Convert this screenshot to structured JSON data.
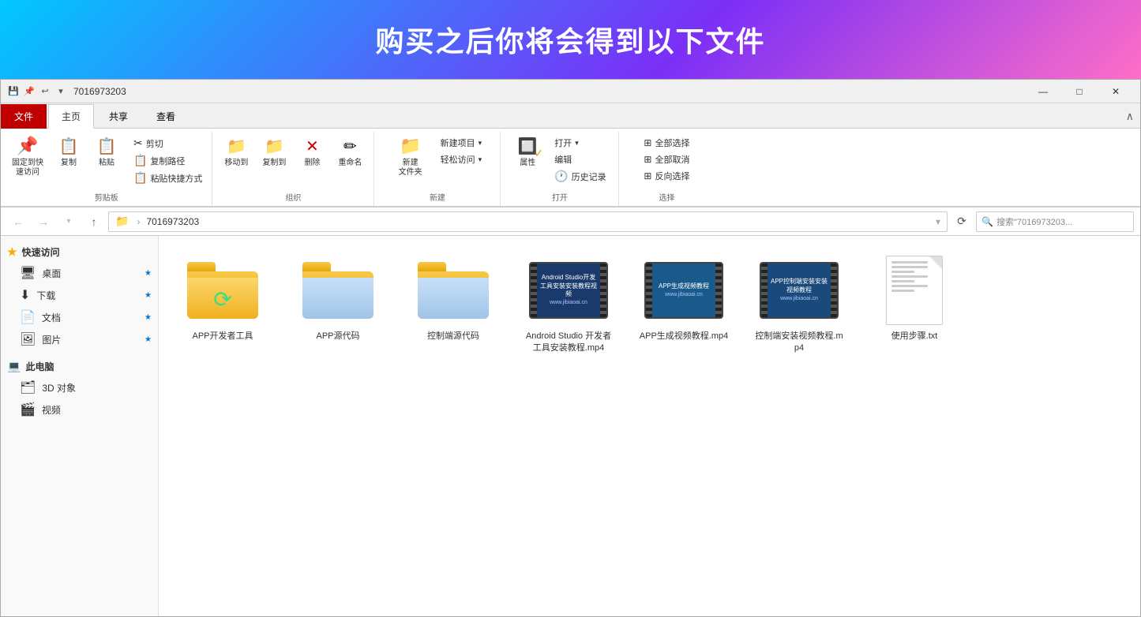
{
  "banner": {
    "title": "购买之后你将会得到以下文件"
  },
  "titlebar": {
    "title": "7016973203",
    "undo_icon": "↩",
    "minimize": "—",
    "maximize": "□",
    "close": "✕"
  },
  "ribbon": {
    "tabs": [
      "文件",
      "主页",
      "共享",
      "查看"
    ],
    "active_tab": "主页",
    "groups": {
      "clipboard": {
        "label": "剪贴板",
        "pin_label": "固定到快\n速访问",
        "copy_label": "复制",
        "paste_label": "粘贴",
        "cut": "剪切",
        "copy_path": "复制路径",
        "paste_shortcut": "粘贴快捷方式"
      },
      "organize": {
        "label": "组织",
        "move_to": "移动到",
        "copy_to": "复制到",
        "delete": "删除",
        "rename": "重命名"
      },
      "new": {
        "label": "新建",
        "new_item": "新建项目",
        "easy_access": "轻松访问",
        "new_folder": "新建\n文件夹"
      },
      "open": {
        "label": "打开",
        "open": "打开",
        "edit": "编辑",
        "history": "历史记录",
        "properties": "属性"
      },
      "select": {
        "label": "选择",
        "select_all": "全部选择",
        "select_none": "全部取消",
        "invert": "反向选择"
      }
    }
  },
  "addressbar": {
    "path": "7016973203",
    "search_placeholder": "搜索\"7016973203..."
  },
  "sidebar": {
    "quick_access_label": "快速访问",
    "items": [
      {
        "label": "桌面",
        "icon": "🖥",
        "pinned": true
      },
      {
        "label": "下载",
        "icon": "⬇",
        "pinned": true
      },
      {
        "label": "文档",
        "icon": "📄",
        "pinned": true
      },
      {
        "label": "图片",
        "icon": "🖼",
        "pinned": true
      }
    ],
    "this_pc_label": "此电脑",
    "pc_items": [
      {
        "label": "3D 对象",
        "icon": "🗂"
      },
      {
        "label": "视频",
        "icon": "🎬"
      }
    ]
  },
  "files": [
    {
      "name": "APP开发者工具",
      "type": "folder",
      "has_android": true
    },
    {
      "name": "APP源代码",
      "type": "folder",
      "has_android": false
    },
    {
      "name": "控制端源代码",
      "type": "folder",
      "has_android": false
    },
    {
      "name": "Android Studio 开发者工具安装教程.mp4",
      "type": "video",
      "color": "#1a3a6b",
      "text": "Android Studio开发工具安装安装教程视频"
    },
    {
      "name": "APP生成视频教程.mp4",
      "type": "video",
      "color": "#1a5a8b",
      "text": "APP生成视频教程\n视频教程\njibiaoai.cn"
    },
    {
      "name": "控制端安装视频教程.mp4",
      "type": "video",
      "color": "#1a4a7b",
      "text": "APP控制端安装安装视频教程\njibiaoai.cn"
    },
    {
      "name": "使用步骤.txt",
      "type": "txt"
    }
  ]
}
